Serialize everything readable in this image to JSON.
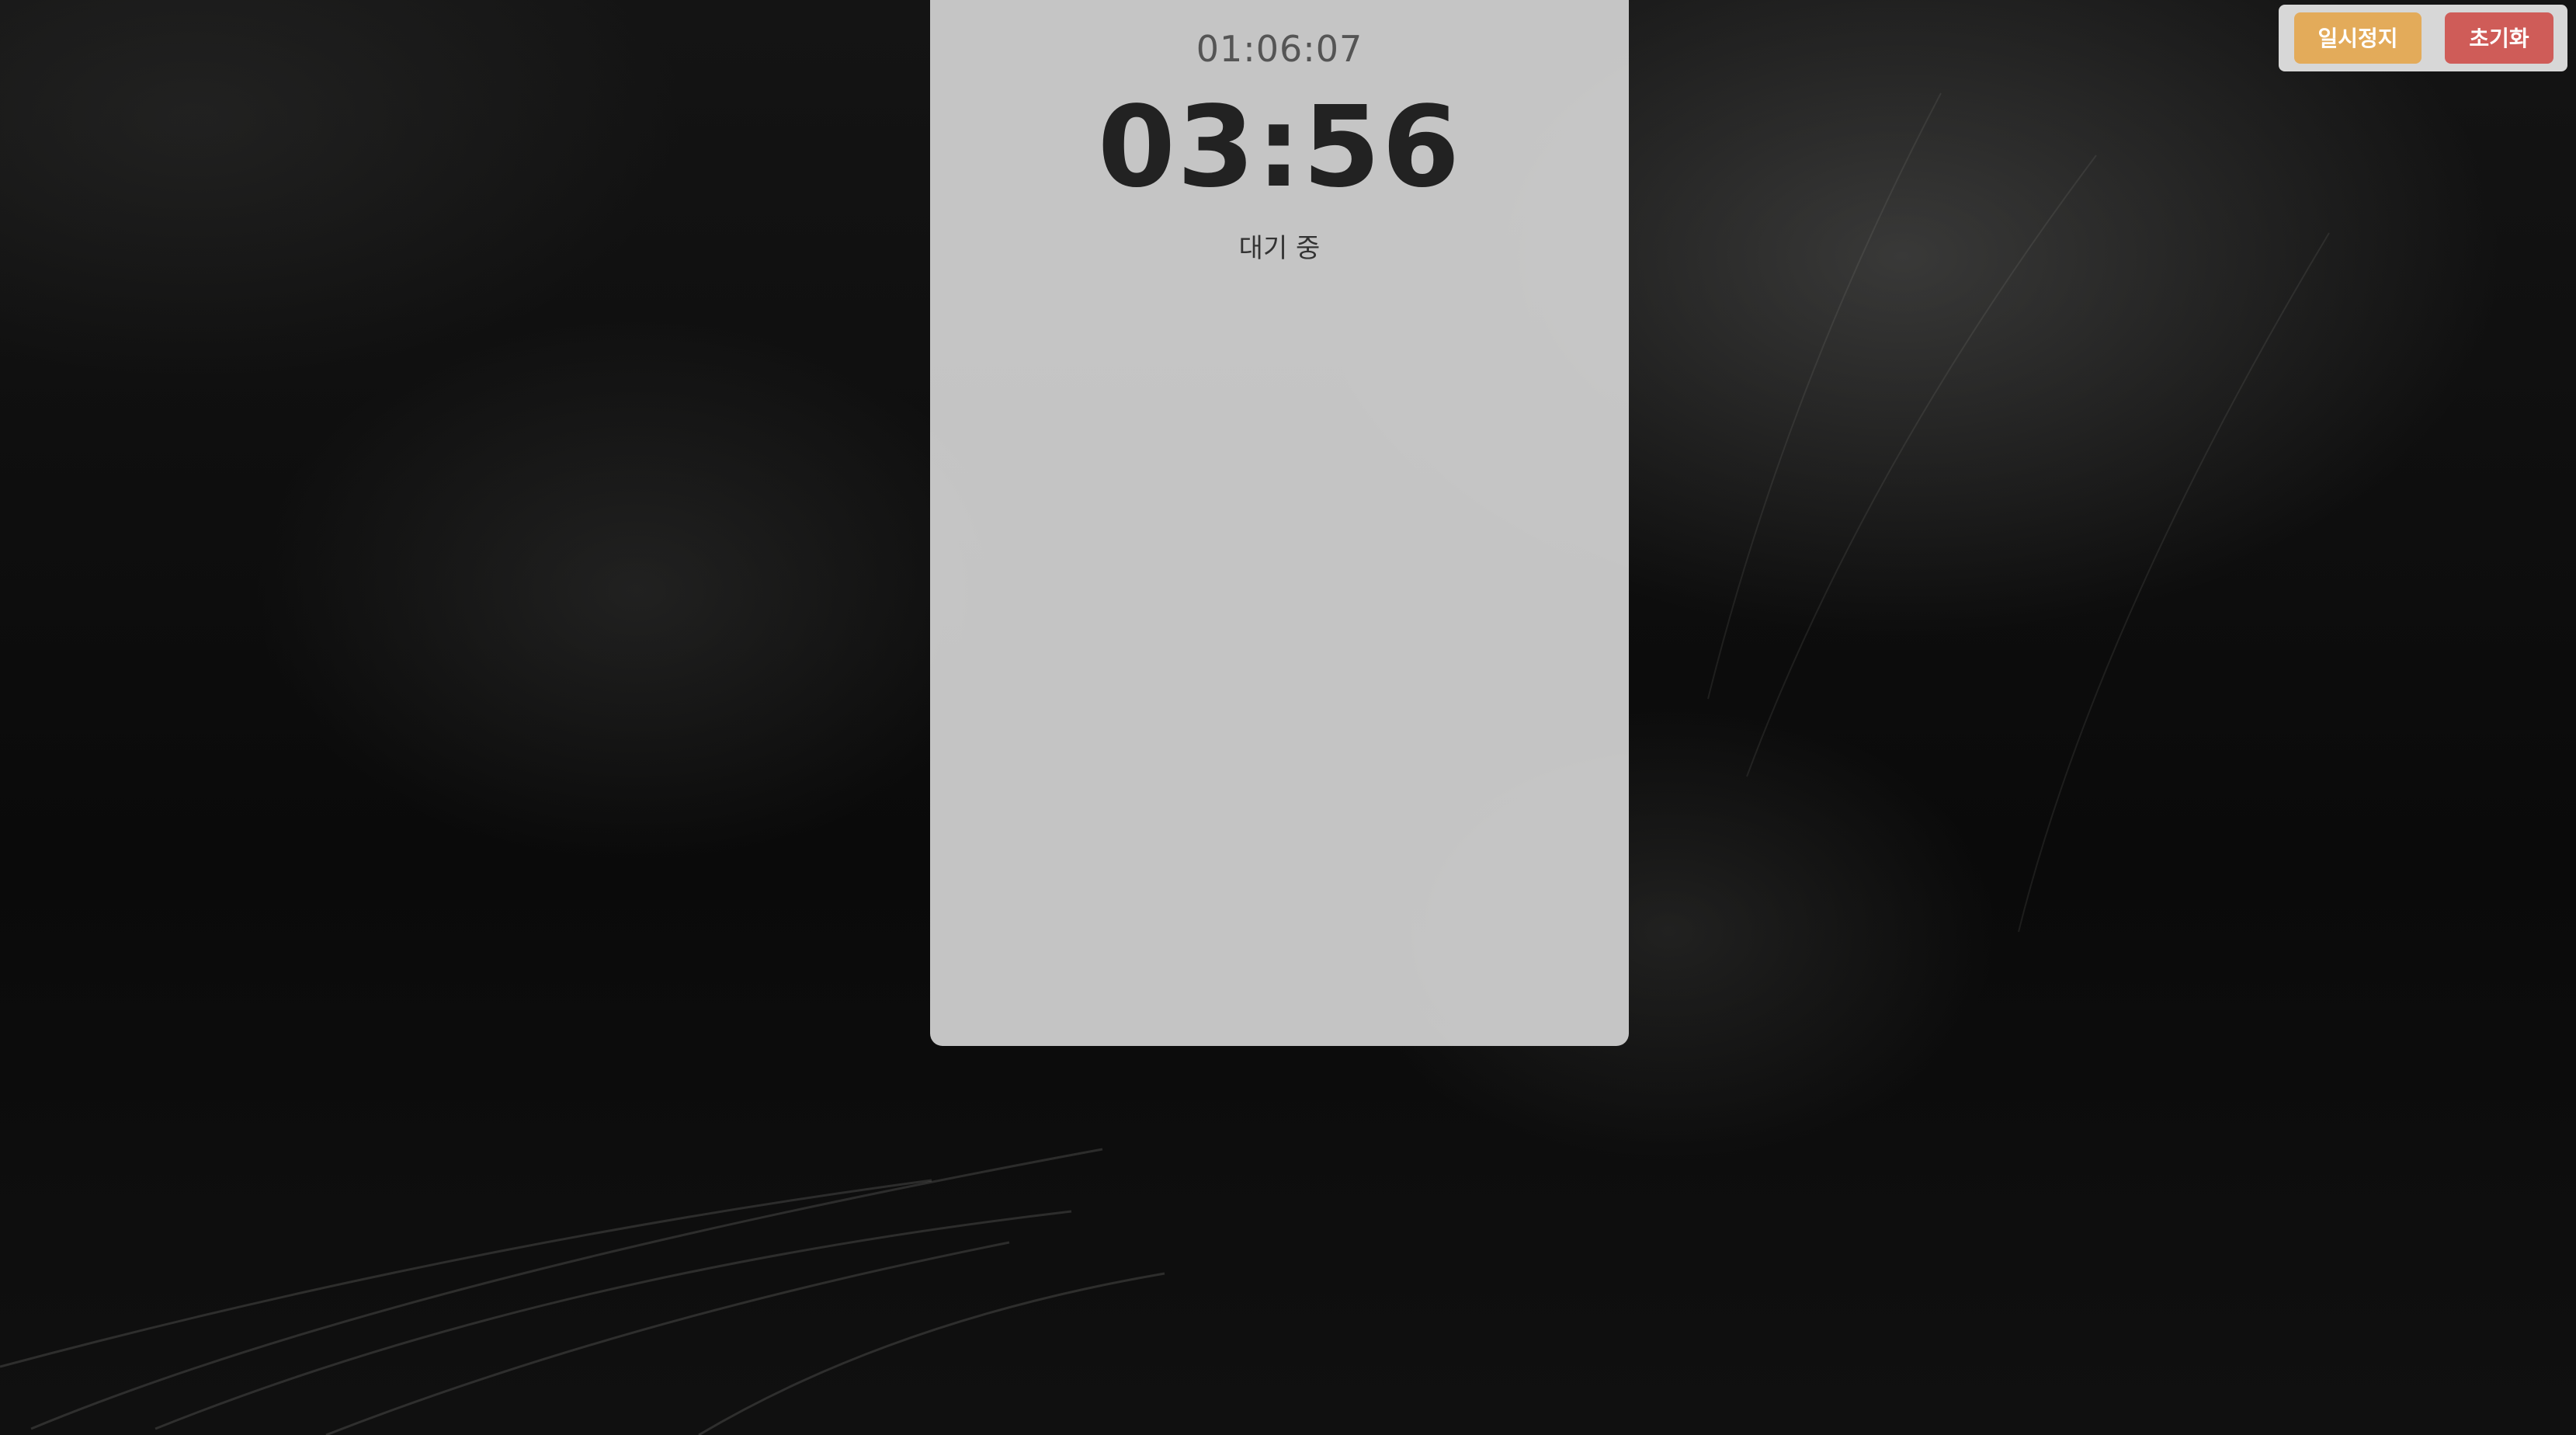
{
  "timer": {
    "clock": "01:06:07",
    "countdown": "03:56",
    "status": "대기 중"
  },
  "controls": {
    "pause_label": "일시정지",
    "reset_label": "초기화",
    "colors": {
      "pause": "#e3ab5a",
      "reset": "#cf5c58"
    }
  },
  "background": {
    "image": "cat-photo"
  }
}
